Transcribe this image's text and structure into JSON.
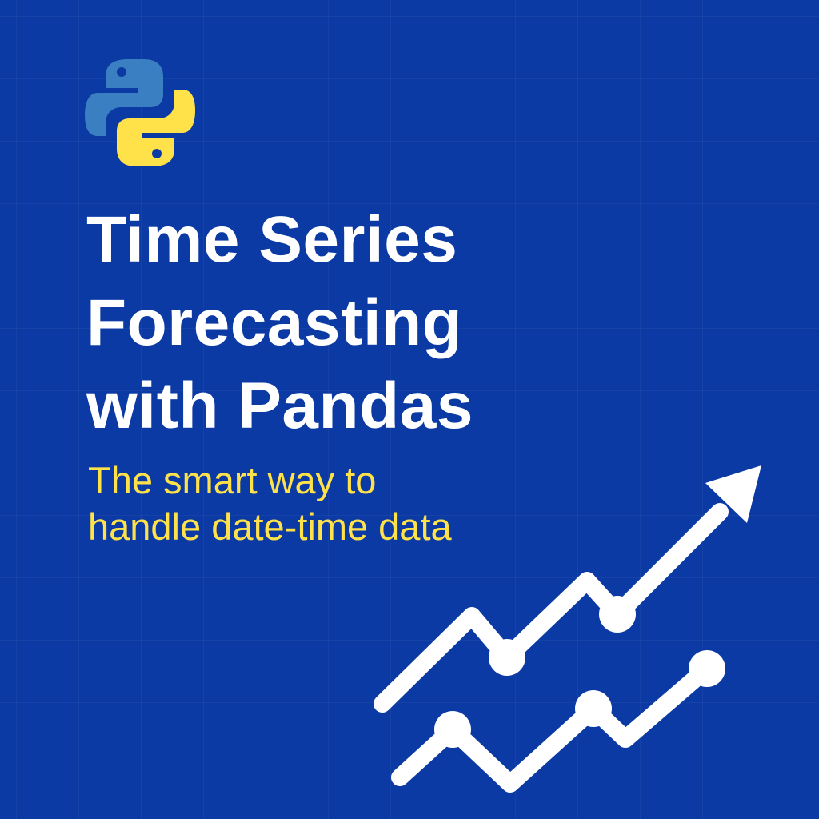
{
  "title": {
    "line1": "Time Series",
    "line2": "Forecasting",
    "line3": "with Pandas"
  },
  "subtitle": {
    "line1": "The smart way to",
    "line2": "handle date-time data"
  },
  "colors": {
    "background": "#0b3aa4",
    "title": "#ffffff",
    "subtitle": "#ffe14a",
    "logo_blue": "#3a7fc1",
    "logo_yellow": "#ffe14a",
    "graphic": "#ffffff"
  },
  "icons": {
    "logo": "python-logo-icon",
    "graphic": "trend-arrow-icon"
  }
}
